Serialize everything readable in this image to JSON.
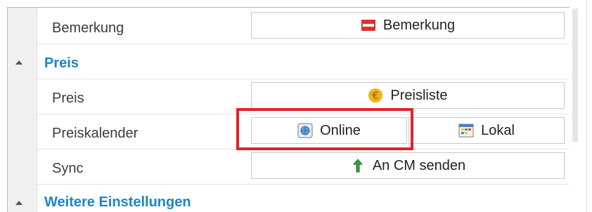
{
  "rows": {
    "bemerkung": {
      "label": "Bemerkung",
      "button": "Bemerkung",
      "icon": "note-red-white-icon"
    },
    "preis_section": {
      "title": "Preis"
    },
    "preis": {
      "label": "Preis",
      "button": "Preisliste",
      "icon": "euro-coin-icon"
    },
    "preiskalender": {
      "label": "Preiskalender",
      "online_button": "Online",
      "online_icon": "globe-calendar-icon",
      "lokal_button": "Lokal",
      "lokal_icon": "calendar-grid-icon"
    },
    "sync": {
      "label": "Sync",
      "button": "An CM senden",
      "icon": "green-up-arrow-icon"
    },
    "weitere_section": {
      "title": "Weitere Einstellungen"
    }
  },
  "colors": {
    "section_title": "#1a86c8",
    "highlight": "#e3212b"
  }
}
